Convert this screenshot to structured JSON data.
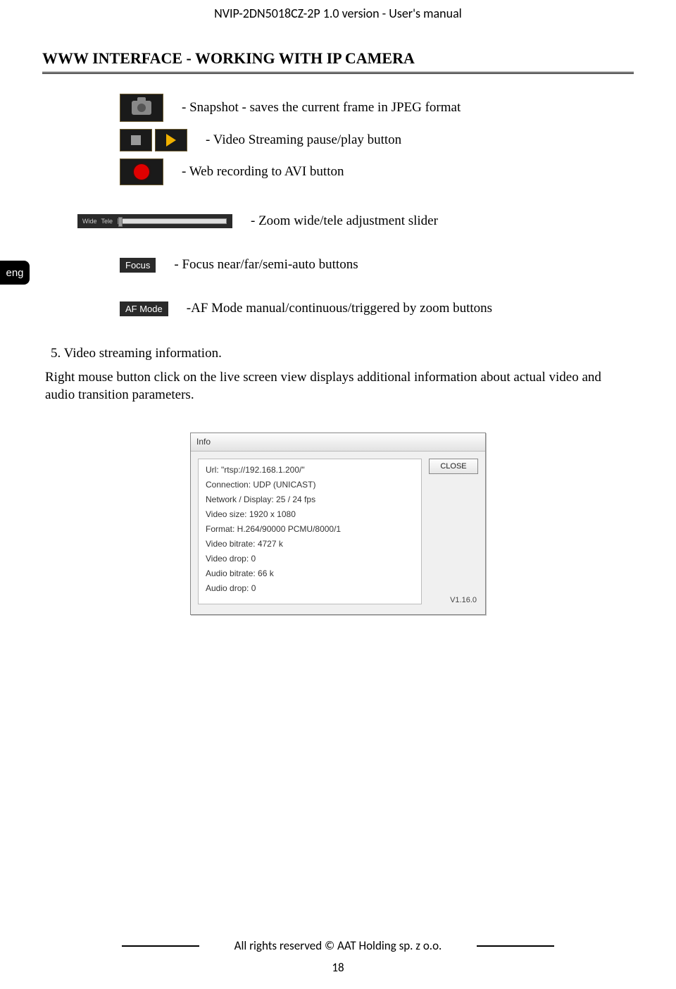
{
  "header": {
    "doc_title": "NVIP-2DN5018CZ-2P 1.0 version - User's manual"
  },
  "section": {
    "title": "WWW INTERFACE - WORKING WITH IP CAMERA"
  },
  "lang_tab": "eng",
  "icons": {
    "snapshot_desc": "- Snapshot - saves the current frame in JPEG format",
    "pauseplay_desc": "- Video Streaming pause/play button",
    "record_desc": "- Web recording to AVI button",
    "zoom": {
      "wide": "Wide",
      "tele": "Tele",
      "desc": "- Zoom wide/tele adjustment slider"
    },
    "focus": {
      "label": "Focus",
      "desc": "- Focus near/far/semi-auto buttons"
    },
    "afmode": {
      "label": "AF Mode",
      "desc": "-AF Mode manual/continuous/triggered by zoom buttons"
    }
  },
  "body": {
    "item5_title": "5.  Video streaming information.",
    "item5_text": "Right mouse button click on the live screen view displays additional information about actual video and audio transition parameters."
  },
  "info_dialog": {
    "title": "Info",
    "close": "CLOSE",
    "version": "V1.16.0",
    "rows": {
      "url": "Url: \"rtsp://192.168.1.200/\"",
      "connection": "Connection: UDP (UNICAST)",
      "netdisp": "Network / Display:  25 / 24 fps",
      "videosize": "Video size: 1920 x 1080",
      "format": "Format: H.264/90000 PCMU/8000/1",
      "vbitrate": "Video bitrate: 4727 k",
      "vdrop": "Video drop: 0",
      "abitrate": "Audio bitrate: 66 k",
      "adrop": "Audio drop: 0"
    }
  },
  "footer": {
    "rights": "All rights reserved © AAT Holding sp. z o.o.",
    "page": "18"
  }
}
